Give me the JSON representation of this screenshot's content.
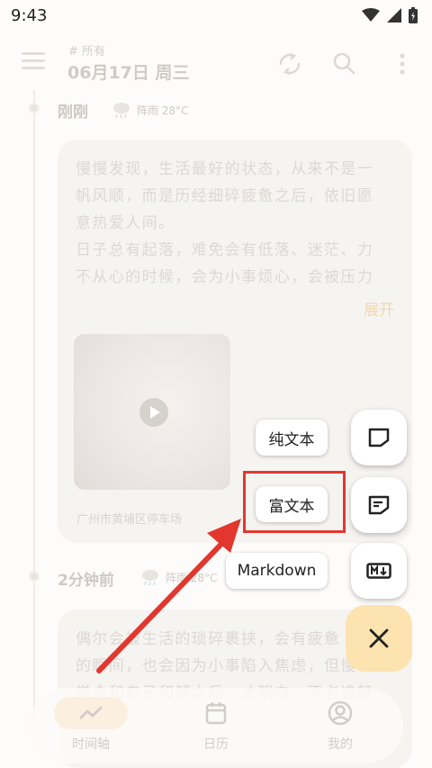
{
  "status_bar": {
    "time": "9:43"
  },
  "app_bar": {
    "filter_tag": "# 所有",
    "date_title": "06月17日 周三",
    "icons": [
      "sync-icon",
      "search-icon",
      "more-vert-icon"
    ]
  },
  "timeline": [
    {
      "time": "刚刚",
      "weather": "阵雨 28°C",
      "text_lines": [
        "慢慢发现，生活最好的状态，从来不是一",
        "帆风顺，而是历经细碎疲惫之后，依旧愿",
        "意热爱人间。",
        "日子总有起落，难免会有低落、迷茫、力",
        "不从心的时候，会为小事烦心，会被压力"
      ],
      "expand": "展开",
      "location": "广州市黄埔区停车场"
    },
    {
      "time": "2分钟前",
      "weather": "阵雨 28°C",
      "text_lines": [
        "偶尔会被生活的琐碎裹挟，会有疲惫",
        "的瞬间，也会因为小事陷入焦虑，但慢",
        "学会和自己和解之后，才明白：不必追赶"
      ]
    }
  ],
  "fab_menu": {
    "plain_text": "纯文本",
    "rich_text": "富文本",
    "markdown": "Markdown"
  },
  "bottom_nav": [
    {
      "label": "时间轴",
      "icon": "timeline-icon"
    },
    {
      "label": "日历",
      "icon": "calendar-icon"
    },
    {
      "label": "我的",
      "icon": "profile-icon"
    }
  ],
  "colors": {
    "accent": "#fde3b0",
    "highlight": "#e2372e",
    "expand": "#efd8b3"
  }
}
